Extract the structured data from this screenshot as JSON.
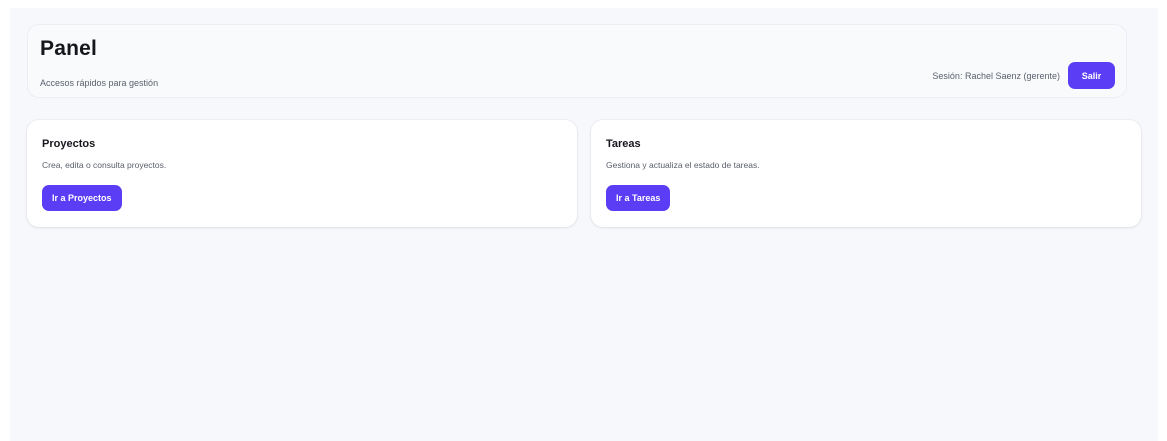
{
  "header": {
    "title": "Panel",
    "subtitle": "Accesos rápidos para gestión",
    "session_text": "Sesión: Rachel Saenz (gerente)",
    "logout_label": "Salir"
  },
  "cards": [
    {
      "title": "Proyectos",
      "description": "Crea, edita o consulta proyectos.",
      "button_label": "Ir a Proyectos"
    },
    {
      "title": "Tareas",
      "description": "Gestiona y actualiza el estado de tareas.",
      "button_label": "Ir a Tareas"
    }
  ],
  "colors": {
    "accent": "#5b3df5",
    "background": "#f7f8fc",
    "card": "#ffffff",
    "text": "#15171c",
    "muted_text": "#5a5f6b"
  }
}
